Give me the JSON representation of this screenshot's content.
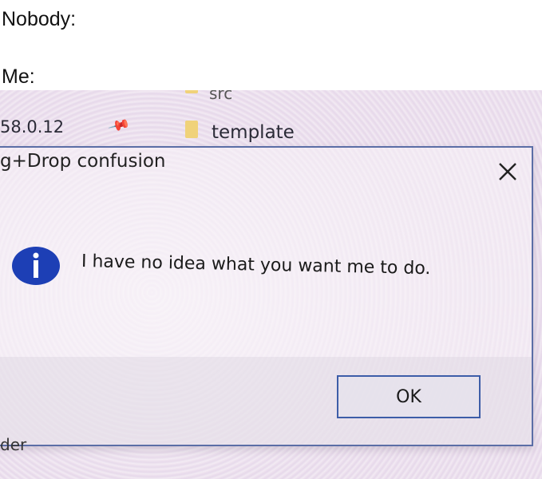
{
  "caption": {
    "line1": "Nobody:",
    "line2": "Me:"
  },
  "explorer": {
    "src_label": "src",
    "version_label": "58.0.12",
    "template_label": "template",
    "bottom_label": "der"
  },
  "dialog": {
    "title": "g+Drop confusion",
    "message": "I have no idea what you want me to do.",
    "ok_label": "OK",
    "close_symbol": "×"
  },
  "colors": {
    "info_icon": "#1d3fb5",
    "dialog_border": "#5b6ea6",
    "ok_border": "#3d5da8"
  },
  "icons": {
    "info": "info-icon",
    "close": "close-icon",
    "pin": "pin-icon",
    "folder": "folder-icon"
  }
}
